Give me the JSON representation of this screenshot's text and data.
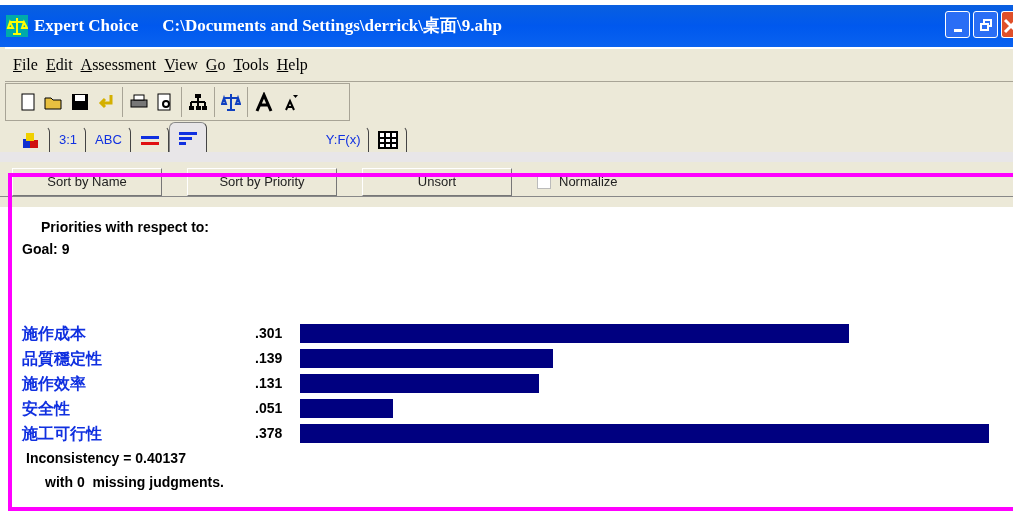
{
  "window": {
    "app_name": "Expert Choice",
    "file_path": "C:\\Documents and Settings\\derrick\\桌面\\9.ahp"
  },
  "menu": [
    "File",
    "Edit",
    "Assessment",
    "View",
    "Go",
    "Tools",
    "Help"
  ],
  "tabs": [
    {
      "kind": "icon",
      "selected": false
    },
    {
      "kind": "text",
      "label": "3:1",
      "selected": false
    },
    {
      "kind": "text",
      "label": "ABC",
      "selected": false
    },
    {
      "kind": "icon",
      "selected": false
    },
    {
      "kind": "icon",
      "selected": true
    },
    {
      "kind": "text",
      "label": "Y:F(x)",
      "selected": false
    },
    {
      "kind": "icon",
      "selected": false
    }
  ],
  "buttons": [
    "Sort by Name",
    "Sort by Priority",
    "Unsort"
  ],
  "normalize": {
    "label": "Normalize",
    "checked": false
  },
  "heading": "Priorities with respect to:",
  "goal": "Goal: 9",
  "rows": [
    {
      "name": "施作成本",
      "value": ".301"
    },
    {
      "name": "品質穩定性",
      "value": ".139"
    },
    {
      "name": "施作效率",
      "value": ".131"
    },
    {
      "name": "安全性",
      "value": ".051"
    },
    {
      "name": "施工可行性",
      "value": ".378"
    }
  ],
  "inconsistency": "Inconsistency = 0.40137",
  "missing": "with 0  missing judgments."
}
